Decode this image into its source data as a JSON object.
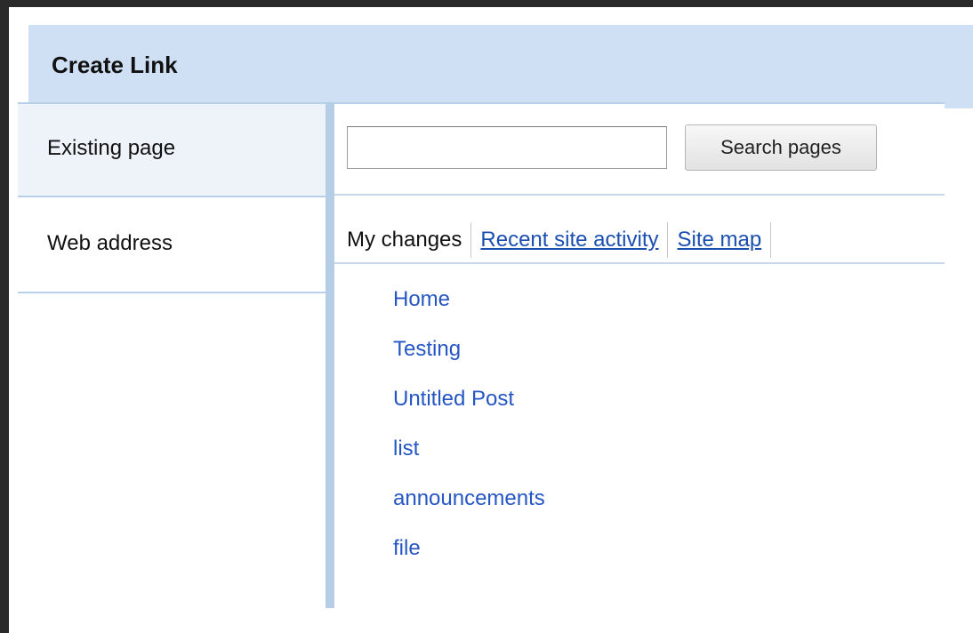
{
  "dialog": {
    "title": "Create Link"
  },
  "nav": {
    "items": [
      {
        "label": "Existing page",
        "selected": true
      },
      {
        "label": "Web address",
        "selected": false
      }
    ]
  },
  "search": {
    "value": "",
    "placeholder": "",
    "button_label": "Search pages"
  },
  "tabs": [
    {
      "label": "My changes",
      "active": true
    },
    {
      "label": "Recent site activity",
      "active": false
    },
    {
      "label": "Site map",
      "active": false
    }
  ],
  "pages": [
    "Home",
    "Testing",
    "Untitled Post",
    "list",
    "announcements",
    "file"
  ],
  "colors": {
    "title_bar": "#cfe0f4",
    "link": "#2556c4",
    "separator": "#b6cde6"
  }
}
